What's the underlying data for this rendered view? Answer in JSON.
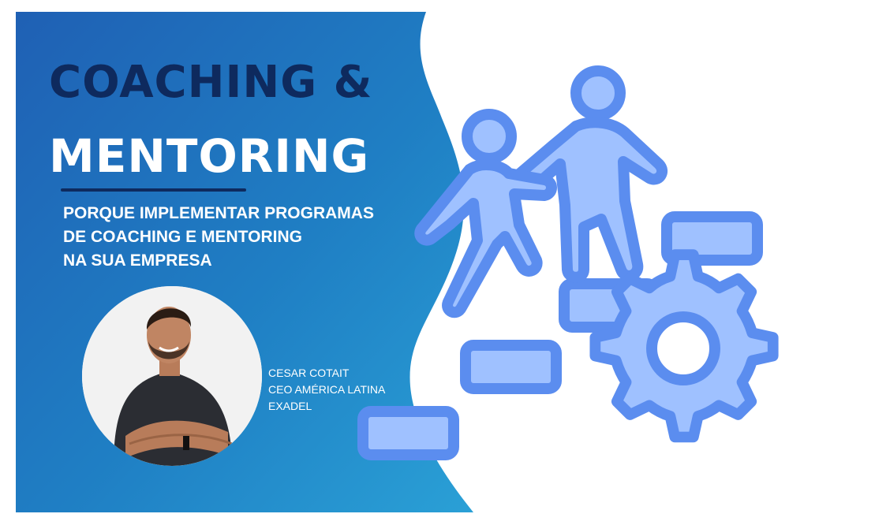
{
  "headline": {
    "line1": "COACHING &",
    "line2": "MENTORING"
  },
  "subtitle": {
    "line1": "PORQUE IMPLEMENTAR PROGRAMAS",
    "line2": "DE COACHING E MENTORING",
    "line3": "NA SUA EMPRESA"
  },
  "speaker": {
    "name": "CESAR COTAIT",
    "role": "CEO AMÉRICA LATINA",
    "company": "EXADEL"
  },
  "colors": {
    "background_blue": "#1f7fc4",
    "headline_dark": "#0e2a5e",
    "icon_stroke": "#5b8def",
    "icon_fill": "#9fc1ff"
  },
  "icons": [
    "climbing-people-icon",
    "step-icon",
    "gear-icon"
  ]
}
